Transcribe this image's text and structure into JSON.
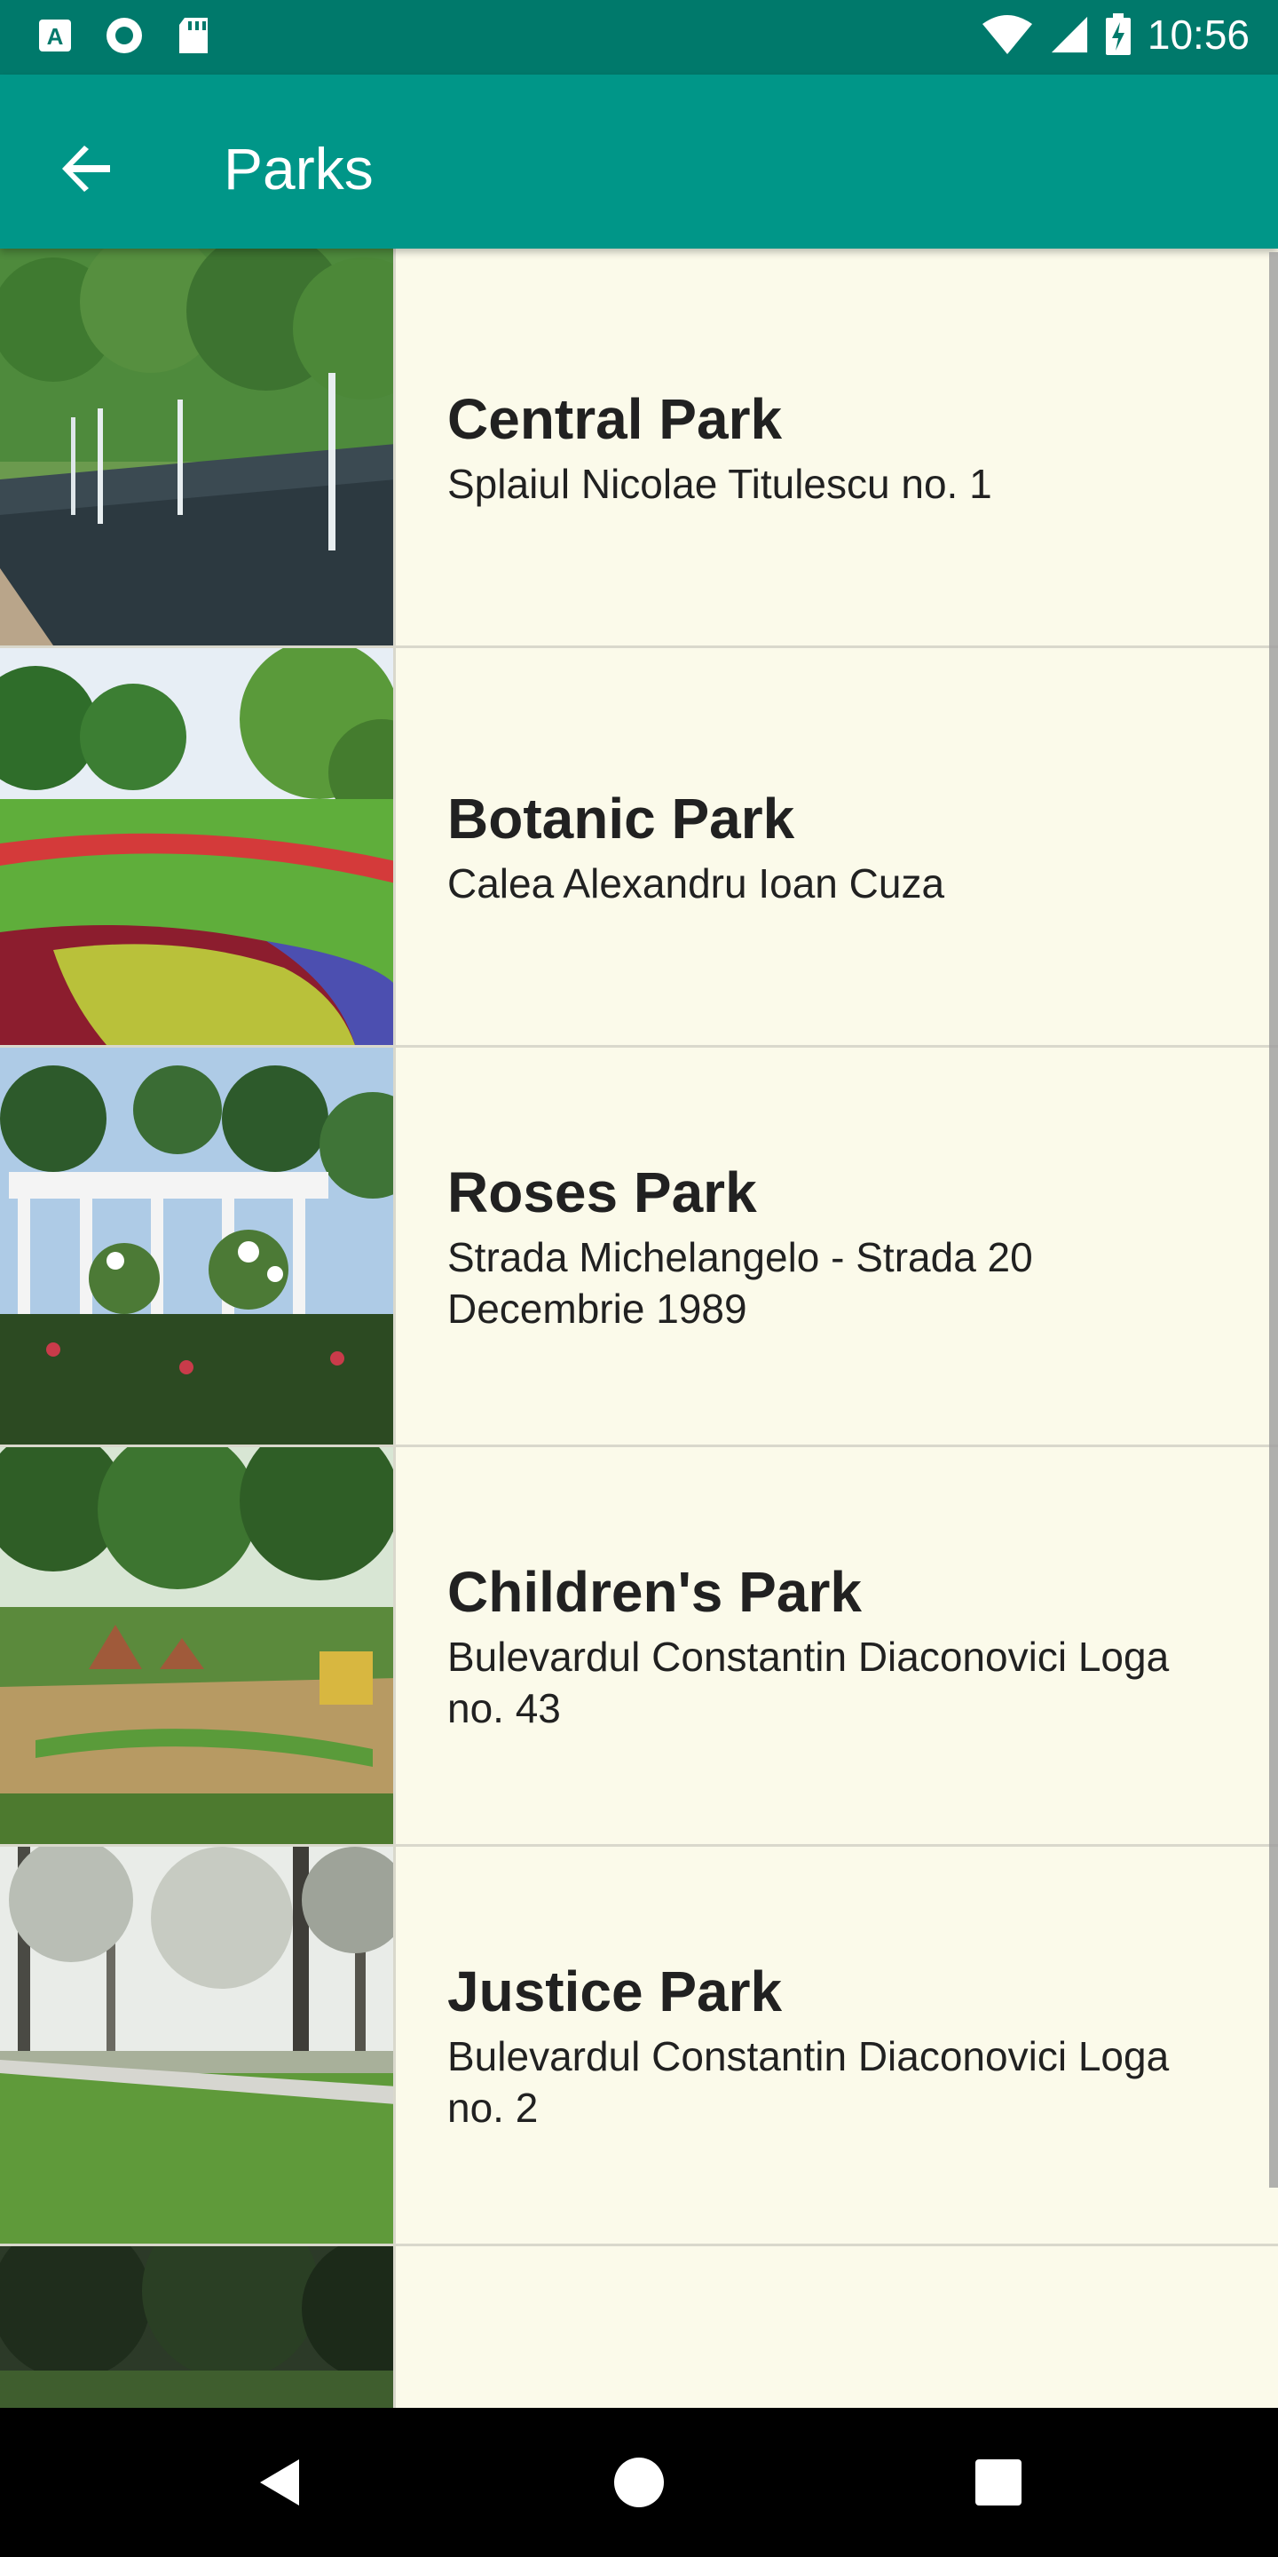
{
  "status_bar": {
    "time": "10:56",
    "left_icons": [
      "a-notification-icon",
      "circle-notification-icon",
      "sd-card-icon"
    ],
    "right_icons": [
      "wifi-icon",
      "cell-signal-icon",
      "battery-charging-icon"
    ]
  },
  "app_bar": {
    "title": "Parks",
    "back_icon": "arrow-left-icon"
  },
  "parks": [
    {
      "name": "Central Park",
      "address": "Splaiul Nicolae Titulescu no. 1"
    },
    {
      "name": "Botanic Park",
      "address": "Calea Alexandru Ioan Cuza"
    },
    {
      "name": "Roses Park",
      "address": "Strada Michelangelo - Strada 20 Decembrie 1989"
    },
    {
      "name": "Children's Park",
      "address": "Bulevardul Constantin Diaconovici Loga no. 43"
    },
    {
      "name": "Justice Park",
      "address": "Bulevardul Constantin Diaconovici Loga no. 2"
    },
    {
      "name": "",
      "address": ""
    }
  ],
  "nav_bar": {
    "icons": [
      "back-triangle-icon",
      "home-circle-icon",
      "recents-square-icon"
    ]
  },
  "colors": {
    "status_bar": "#00796b",
    "app_bar": "#009688",
    "list_background": "#fbfaea",
    "text": "#212121"
  }
}
